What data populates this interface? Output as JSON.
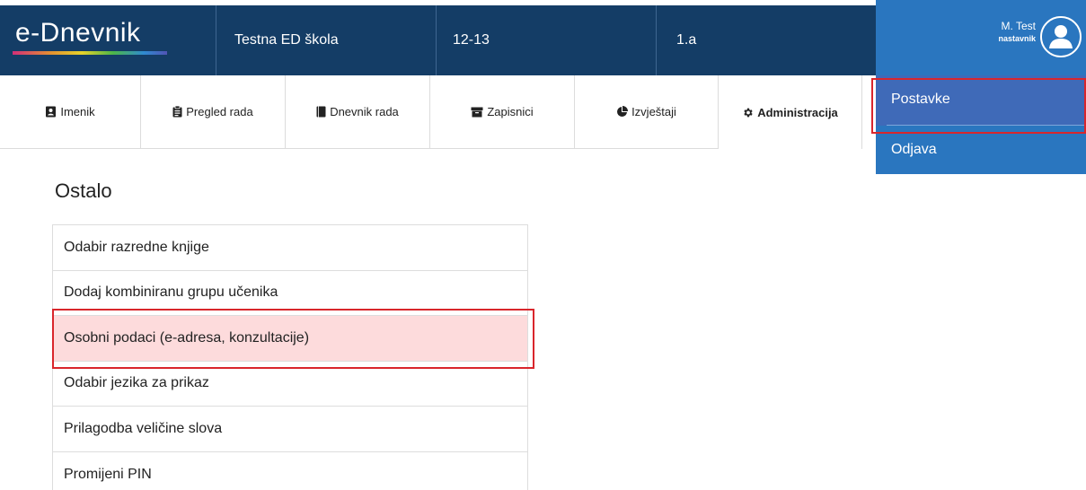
{
  "header": {
    "brand": "e-Dnevnik",
    "school": "Testna ED škola",
    "year": "12-13",
    "class": "1.a"
  },
  "user": {
    "name": "M. Test",
    "role": "nastavnik"
  },
  "nav": {
    "tabs": [
      {
        "label": "Imenik",
        "icon": "address-book-icon"
      },
      {
        "label": "Pregled rada",
        "icon": "clipboard-icon"
      },
      {
        "label": "Dnevnik rada",
        "icon": "book-icon"
      },
      {
        "label": "Zapisnici",
        "icon": "archive-icon"
      },
      {
        "label": "Izvještaji",
        "icon": "pie-chart-icon"
      },
      {
        "label": "Administracija",
        "icon": "gear-icon",
        "active": true
      }
    ]
  },
  "user_menu": {
    "settings": "Postavke",
    "logout": "Odjava"
  },
  "main": {
    "title": "Ostalo",
    "items": [
      "Odabir razredne knjige",
      "Dodaj kombiniranu grupu učenika",
      "Osobni podaci (e-adresa, konzultacije)",
      "Odabir jezika za prikaz",
      "Prilagodba veličine slova",
      "Promijeni PIN"
    ],
    "selected_index": 2
  },
  "colors": {
    "header_bg": "#143d66",
    "user_bg": "#2a76bf",
    "highlight_border": "#d9262c",
    "selected_row": "#fddbdc"
  }
}
